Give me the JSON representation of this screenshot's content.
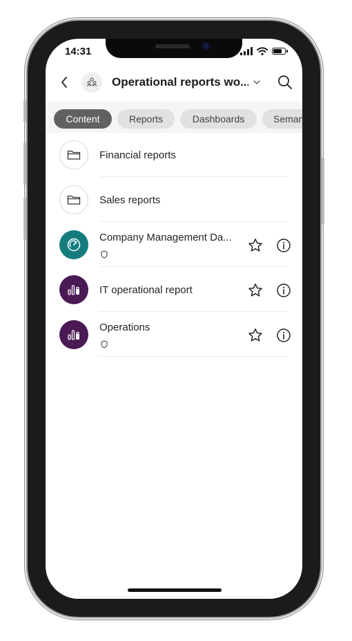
{
  "status_bar": {
    "time": "14:31"
  },
  "header": {
    "title": "Operational reports wo...",
    "icons": {
      "back": "chevron-left-icon",
      "workspace": "people-group-icon",
      "dropdown": "chevron-down-icon",
      "search": "search-icon"
    }
  },
  "filters": [
    {
      "label": "Content",
      "active": true
    },
    {
      "label": "Reports",
      "active": false
    },
    {
      "label": "Dashboards",
      "active": false
    },
    {
      "label": "Seman",
      "active": false
    }
  ],
  "items": [
    {
      "label": "Financial reports",
      "type": "folder",
      "icon": "folder-icon"
    },
    {
      "label": "Sales reports",
      "type": "folder",
      "icon": "folder-icon"
    },
    {
      "label": "Company Management Da...",
      "type": "dashboard",
      "icon": "gauge-icon",
      "color": "#167d7f",
      "sensitivity": true
    },
    {
      "label": "IT operational report",
      "type": "report",
      "icon": "report-chart-icon",
      "color": "#4b1a55",
      "sensitivity": false
    },
    {
      "label": "Operations",
      "type": "report",
      "icon": "report-chart-icon",
      "color": "#4b1a55",
      "sensitivity": true
    }
  ],
  "colors": {
    "active_chip": "#616161",
    "chip": "#e1e1e1",
    "filter_bar": "#f5f5f5"
  }
}
